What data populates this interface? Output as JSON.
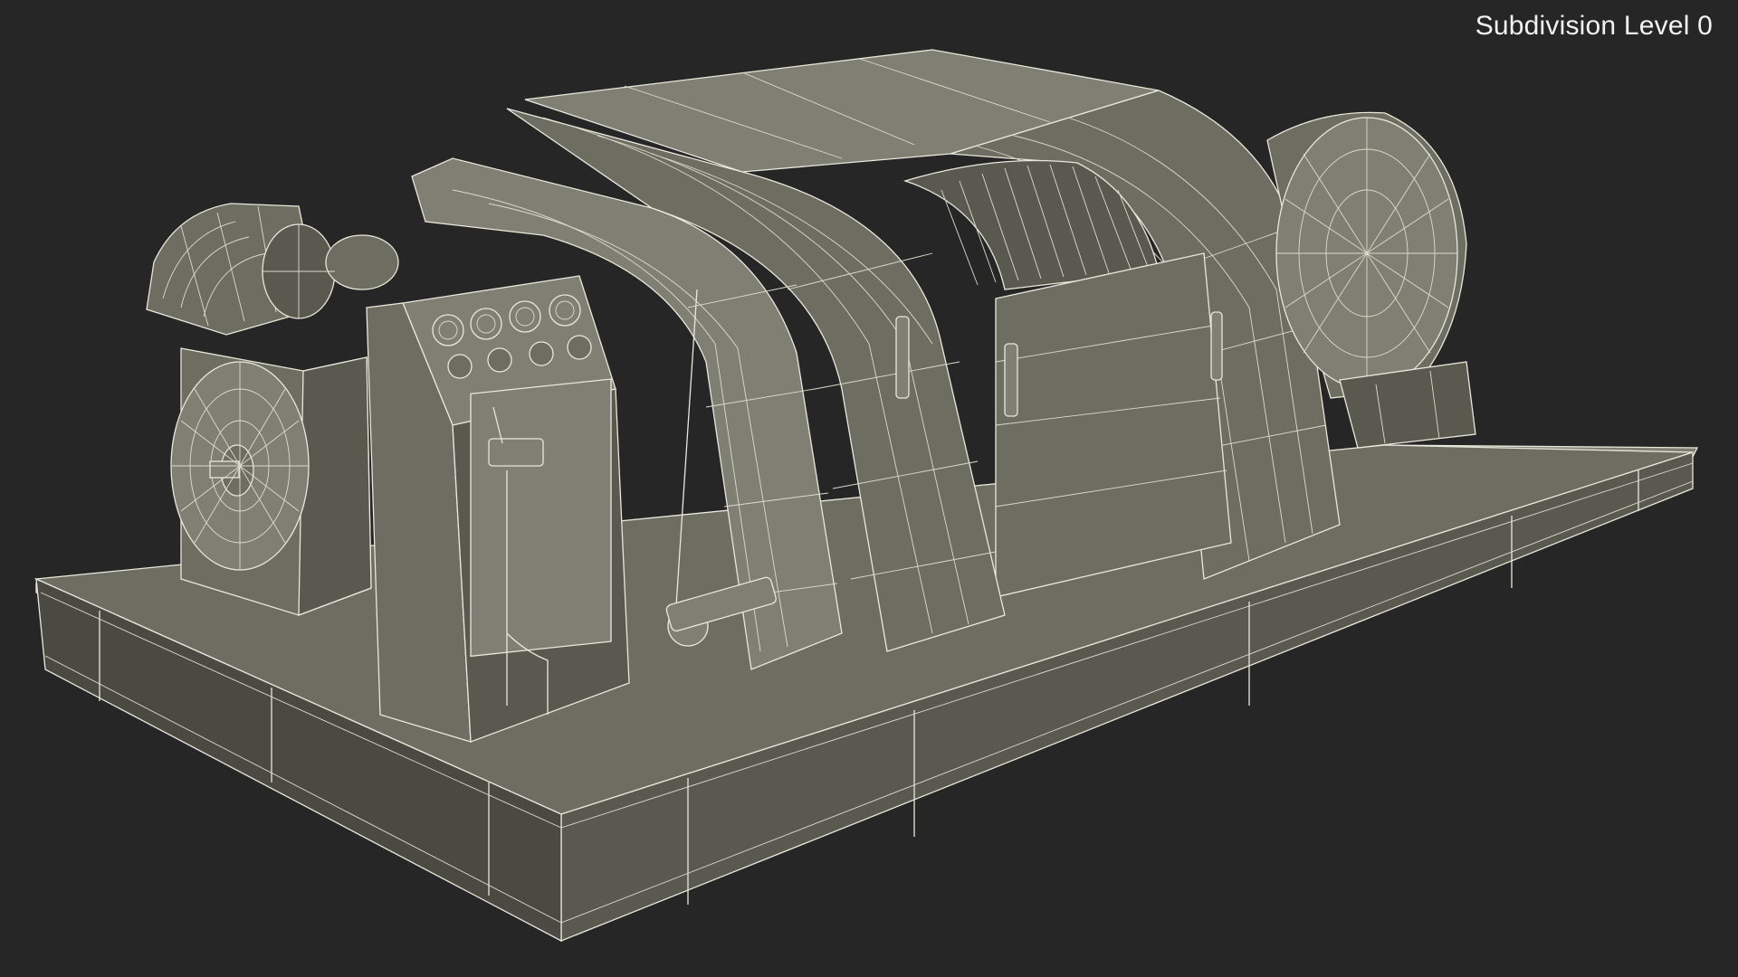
{
  "viewport": {
    "subdivision_label": "Subdivision Level 0",
    "background": "#262626",
    "model_color": "#807f73",
    "wire_color": "#e8e8dc"
  },
  "model": {
    "control_panel": {
      "gauges": 4,
      "knobs": 4
    }
  }
}
